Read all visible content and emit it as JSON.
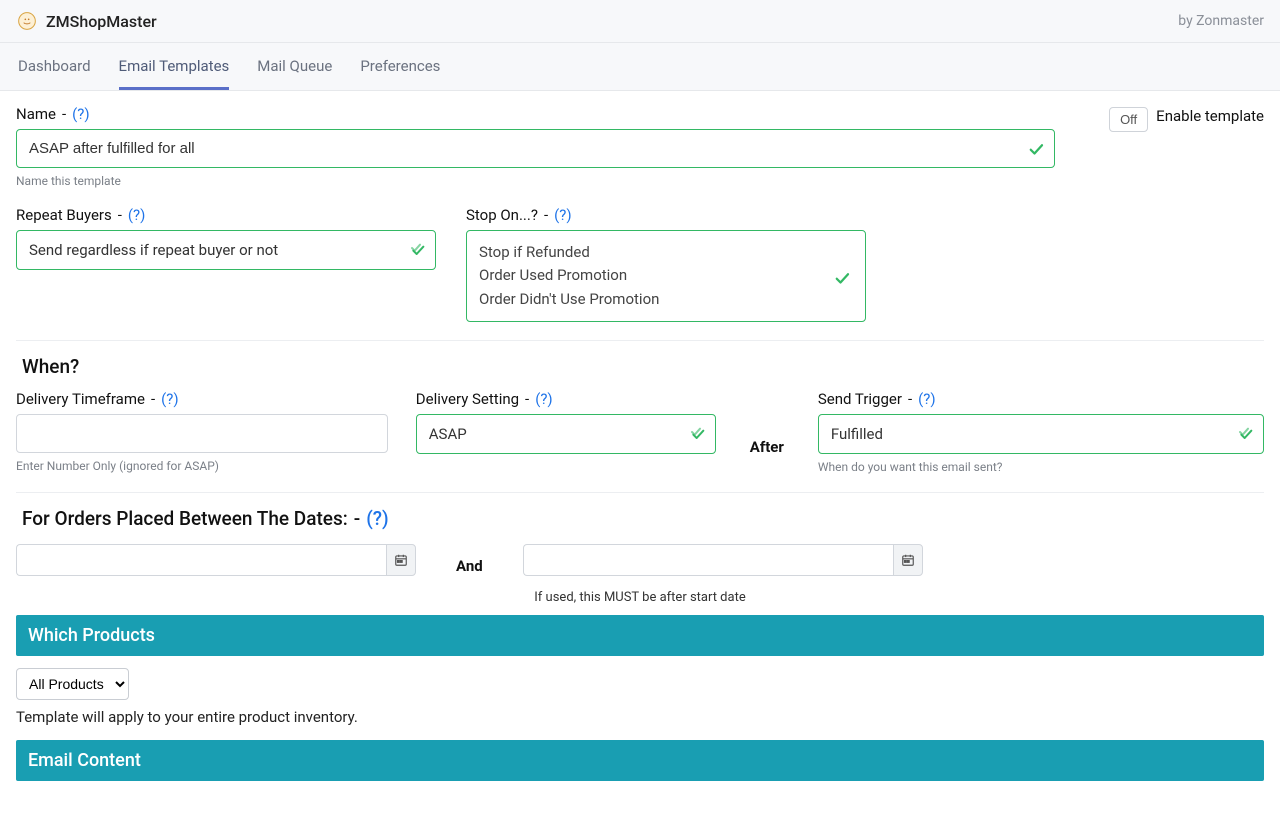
{
  "header": {
    "appName": "ZMShopMaster",
    "byline": "by Zonmaster"
  },
  "tabs": [
    "Dashboard",
    "Email Templates",
    "Mail Queue",
    "Preferences"
  ],
  "activeTab": 1,
  "enable": {
    "state": "Off",
    "label": "Enable template"
  },
  "name": {
    "label": "Name",
    "helpText": "(?)",
    "value": "ASAP after fulfilled for all",
    "helper": "Name this template"
  },
  "repeatBuyers": {
    "label": "Repeat Buyers",
    "helpText": "(?)",
    "value": "Send regardless if repeat buyer or not"
  },
  "stopOn": {
    "label": "Stop On...?",
    "helpText": "(?)",
    "options": [
      "Stop if Refunded",
      "Order Used Promotion",
      "Order Didn't Use Promotion"
    ]
  },
  "when": {
    "title": "When?",
    "timeframe": {
      "label": "Delivery Timeframe",
      "helpText": "(?)",
      "value": "",
      "helper": "Enter Number Only (ignored for ASAP)"
    },
    "setting": {
      "label": "Delivery Setting",
      "helpText": "(?)",
      "value": "ASAP"
    },
    "afterWord": "After",
    "trigger": {
      "label": "Send Trigger",
      "helpText": "(?)",
      "value": "Fulfilled",
      "helper": "When do you want this email sent?"
    }
  },
  "dates": {
    "title": "For Orders Placed Between The Dates:",
    "helpText": "(?)",
    "andWord": "And",
    "note": "If used, this MUST be after start date"
  },
  "products": {
    "banner": "Which Products",
    "selected": "All Products",
    "note": "Template will apply to your entire product inventory."
  },
  "emailContent": {
    "banner": "Email Content"
  }
}
